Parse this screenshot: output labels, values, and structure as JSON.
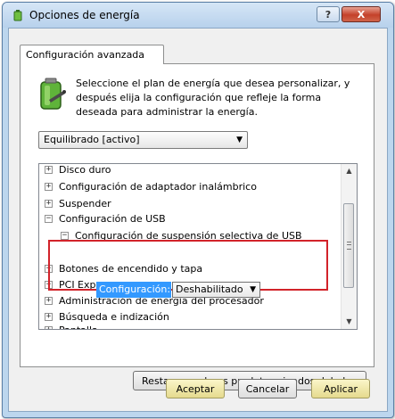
{
  "window": {
    "title": "Opciones de energía",
    "help_label": "?",
    "close_label": "X"
  },
  "tab": {
    "label": "Configuración avanzada"
  },
  "description": "Seleccione el plan de energía que desea personalizar, y después elija la configuración que refleje la forma deseada para administrar la energía.",
  "plan_selector": {
    "value": "Equilibrado [activo]"
  },
  "tree": {
    "collapsed_symbol": "+",
    "expanded_symbol": "−",
    "items": [
      {
        "label": "Disco duro",
        "expanded": false
      },
      {
        "label": "Configuración de adaptador inalámbrico",
        "expanded": false
      },
      {
        "label": "Suspender",
        "expanded": false
      },
      {
        "label": "Configuración de USB",
        "expanded": true
      },
      {
        "label": "Configuración de suspensión selectiva de USB",
        "expanded": true
      },
      {
        "label": "Botones de encendido y tapa",
        "expanded": false
      },
      {
        "label": "PCI Express",
        "expanded": false
      },
      {
        "label": "Administración de energía del procesador",
        "expanded": false
      },
      {
        "label": "Búsqueda e indización",
        "expanded": false
      },
      {
        "label": "Pantalla",
        "expanded": false
      }
    ],
    "setting": {
      "label": "Configuración:",
      "value": "Deshabilitado"
    }
  },
  "buttons": {
    "restore": "Restaurar valores predeterminados del plan",
    "ok": "Aceptar",
    "cancel": "Cancelar",
    "apply": "Aplicar"
  },
  "colors": {
    "selection": "#3399ff",
    "highlight_border": "#d2232a",
    "default_button": "#e5da8e"
  }
}
